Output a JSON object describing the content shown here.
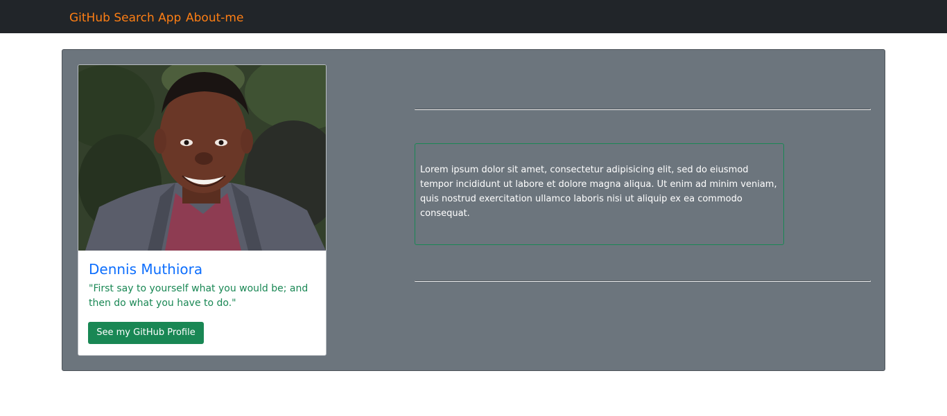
{
  "nav": {
    "brand": "GitHub Search App",
    "about": "About-me",
    "link_color": "#fd7e14",
    "background": "#212529"
  },
  "profile": {
    "name": "Dennis Muthiora",
    "quote": "\"First say to yourself what you would be; and then do what you have to do.\"",
    "button_label": "See my GitHub Profile",
    "photo_alt": "Profile photo of Dennis Muthiora"
  },
  "about": {
    "text": "Lorem ipsum dolor sit amet, consectetur adipisicing elit, sed do eiusmod tempor incididunt ut labore et dolore magna aliqua. Ut enim ad minim veniam, quis nostrud exercitation ullamco laboris nisi ut aliquip ex ea commodo consequat."
  },
  "colors": {
    "panel": "#6c757d",
    "name": "#0d6efd",
    "quote": "#198754",
    "button": "#198754",
    "box_border": "#198754"
  }
}
